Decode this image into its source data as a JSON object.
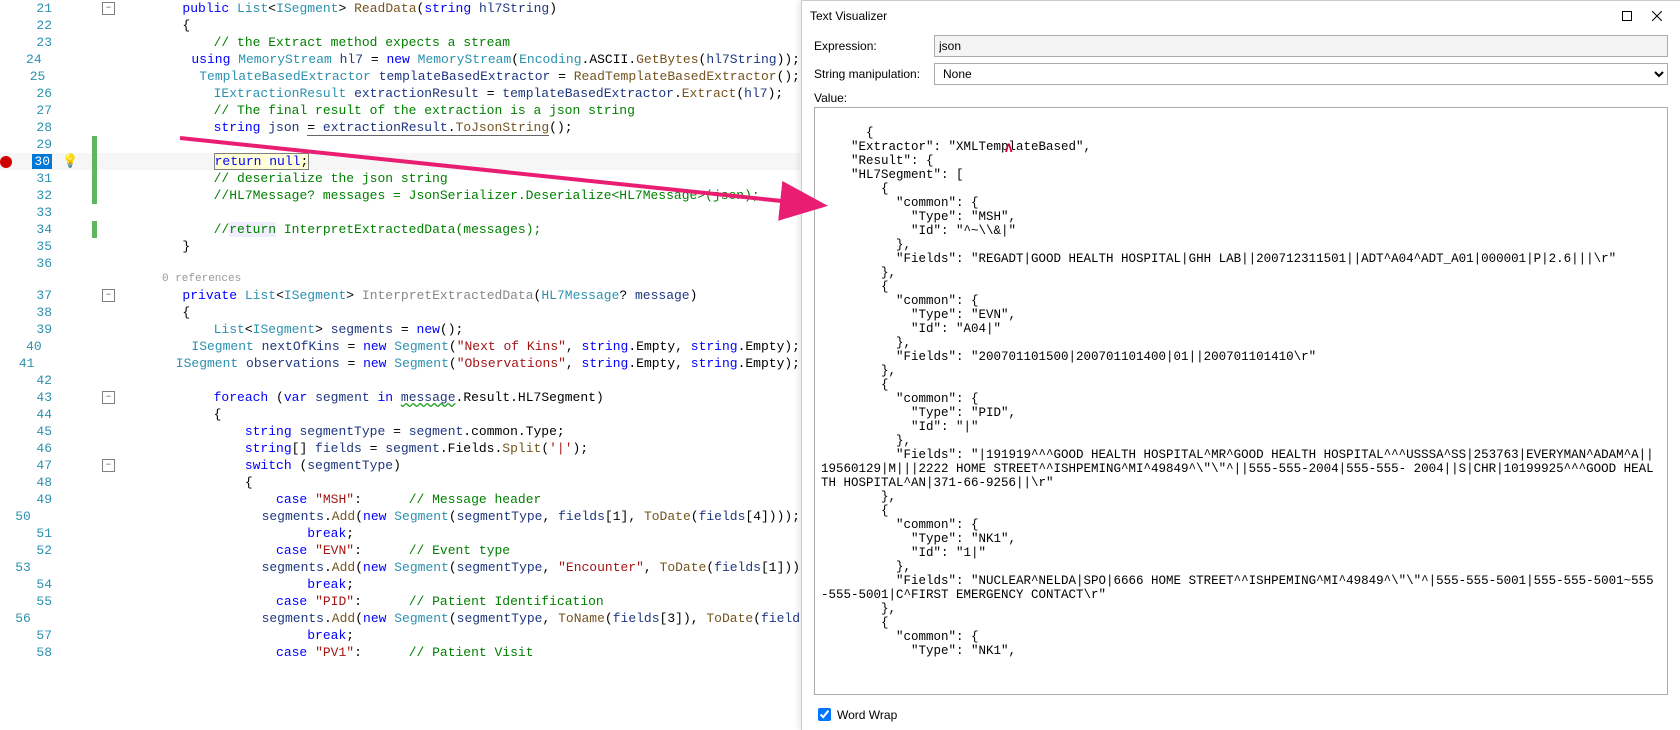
{
  "editor": {
    "lines": [
      {
        "n": 21,
        "fold": "m",
        "html": "<span class='kw'>public</span> <span class='tp'>List</span>&lt;<span class='tp'>ISegment</span>&gt; <span class='mth'>ReadData</span>(<span class='kw'>string</span> <span class='loc'>hl7String</span>)"
      },
      {
        "n": 22,
        "html": "{"
      },
      {
        "n": 23,
        "html": "    <span class='cmt'>// the Extract method expects a stream</span>"
      },
      {
        "n": 24,
        "html": "    <span class='kw'>using</span> <span class='tp'>MemoryStream</span> <span class='loc'>hl7</span> = <span class='kw'>new</span> <span class='tp'>MemoryStream</span>(<span class='tp'>Encoding</span>.ASCII.<span class='mth'>GetBytes</span>(<span class='loc'>hl7String</span>));"
      },
      {
        "n": 25,
        "html": "    <span class='tp'>TemplateBasedExtractor</span> <span class='loc'>templateBasedExtractor</span> = <span class='mth'>ReadTemplateBasedExtractor</span>();"
      },
      {
        "n": 26,
        "html": "    <span class='tp'>IExtractionResult</span> <span class='loc'>extractionResult</span> = <span class='loc'>templateBasedExtractor</span>.<span class='mth'>Extract</span>(<span class='loc'>hl7</span>);"
      },
      {
        "n": 27,
        "html": "    <span class='cmt'>// The final result of the extraction is a json string</span>"
      },
      {
        "n": 28,
        "html": "    <span class='kw'>string</span> <span class='loc'>json</span> <span style='border-bottom:1px solid #666'>= <span class='loc'>extractionResult</span>.<span class='mth'>ToJsonString</span></span>();"
      },
      {
        "n": 29,
        "changed": true,
        "html": ""
      },
      {
        "n": 30,
        "bp": true,
        "hl": true,
        "bulb": true,
        "changed": true,
        "html": "    <span class='boxed'><span class='kw'>return</span> <span class='kw'>null</span>;</span>"
      },
      {
        "n": 31,
        "changed": true,
        "html": "    <span class='cmt'>// deserialize the json string</span>"
      },
      {
        "n": 32,
        "changed": true,
        "html": "    <span class='cmt'>//HL7Message? messages = JsonSerializer.Deserialize&lt;HL7Message&gt;(json);</span>"
      },
      {
        "n": 33,
        "html": ""
      },
      {
        "n": 34,
        "changed": true,
        "html": "    <span class='cmt'>//<span style='background:#eef'>return</span> InterpretExtractedData(messages);</span>"
      },
      {
        "n": 35,
        "html": "}"
      },
      {
        "n": 36,
        "html": ""
      }
    ],
    "refs": "0 references",
    "lines2": [
      {
        "n": 37,
        "fold": "m",
        "html": "<span class='kw'>private</span> <span class='tp'>List</span>&lt;<span class='tp'>ISegment</span>&gt; <span class='gray'>InterpretExtractedData</span>(<span class='tp'>HL7Message</span>? <span class='loc'>message</span>)"
      },
      {
        "n": 38,
        "html": "{"
      },
      {
        "n": 39,
        "html": "    <span class='tp'>List</span>&lt;<span class='tp'>ISegment</span>&gt; <span class='loc'>segments</span> = <span class='kw'>new</span>();"
      },
      {
        "n": 40,
        "html": "    <span class='tp'>ISegment</span> <span class='loc'>nextOfKins</span> = <span class='kw'>new</span> <span class='tp'>Segment</span>(<span class='str'>\"Next of Kins\"</span>, <span class='kw'>string</span>.Empty, <span class='kw'>string</span>.Empty);"
      },
      {
        "n": 41,
        "html": "    <span class='tp'>ISegment</span> <span class='loc'>observations</span> = <span class='kw'>new</span> <span class='tp'>Segment</span>(<span class='str'>\"Observations\"</span>, <span class='kw'>string</span>.Empty, <span class='kw'>string</span>.Empty);"
      },
      {
        "n": 42,
        "html": ""
      },
      {
        "n": 43,
        "fold": "m",
        "html": "    <span class='kw'>foreach</span> (<span class='kw'>var</span> <span class='loc'>segment</span> <span class='kw'>in</span> <span class='loc squig'>message</span>.Result.HL7Segment)"
      },
      {
        "n": 44,
        "html": "    {"
      },
      {
        "n": 45,
        "html": "        <span class='kw'>string</span> <span class='loc'>segmentType</span> = <span class='loc'>segment</span>.common.Type;"
      },
      {
        "n": 46,
        "html": "        <span class='kw'>string</span>[] <span class='loc'>fields</span> = <span class='loc'>segment</span>.Fields.<span class='mth'>Split</span>(<span class='str'>'|'</span>);"
      },
      {
        "n": 47,
        "fold": "m",
        "html": "        <span class='kw'>switch</span> (<span class='loc'>segmentType</span>)"
      },
      {
        "n": 48,
        "html": "        {"
      },
      {
        "n": 49,
        "html": "            <span class='kw'>case</span> <span class='str'>\"MSH\"</span>:      <span class='cmt'>// Message header</span>"
      },
      {
        "n": 50,
        "html": "                <span class='loc'>segments</span>.<span class='mth'>Add</span>(<span class='kw'>new</span> <span class='tp'>Segment</span>(<span class='loc'>segmentType</span>, <span class='loc'>fields</span>[<span class='num'>1</span>], <span class='mth'>ToDate</span>(<span class='loc'>fields</span>[<span class='num'>4</span>])));"
      },
      {
        "n": 51,
        "html": "                <span class='kw'>break</span>;"
      },
      {
        "n": 52,
        "html": "            <span class='kw'>case</span> <span class='str'>\"EVN\"</span>:      <span class='cmt'>// Event type</span>"
      },
      {
        "n": 53,
        "html": "                <span class='loc'>segments</span>.<span class='mth'>Add</span>(<span class='kw'>new</span> <span class='tp'>Segment</span>(<span class='loc'>segmentType</span>, <span class='str'>\"Encounter\"</span>, <span class='mth'>ToDate</span>(<span class='loc'>fields</span>[<span class='num'>1</span>]))"
      },
      {
        "n": 54,
        "html": "                <span class='kw'>break</span>;"
      },
      {
        "n": 55,
        "html": "            <span class='kw'>case</span> <span class='str'>\"PID\"</span>:      <span class='cmt'>// Patient Identification</span>"
      },
      {
        "n": 56,
        "html": "                <span class='loc'>segments</span>.<span class='mth'>Add</span>(<span class='kw'>new</span> <span class='tp'>Segment</span>(<span class='loc'>segmentType</span>, <span class='mth'>ToName</span>(<span class='loc'>fields</span>[<span class='num'>3</span>]), <span class='mth'>ToDate</span>(<span class='loc'>field</span>"
      },
      {
        "n": 57,
        "html": "                <span class='kw'>break</span>;"
      },
      {
        "n": 58,
        "html": "            <span class='kw'>case</span> <span class='str'>\"PV1\"</span>:      <span class='cmt'>// Patient Visit</span>"
      }
    ]
  },
  "dialog": {
    "title": "Text Visualizer",
    "expr_label": "Expression:",
    "expr_value": "json",
    "manip_label": "String manipulation:",
    "manip_value": "None",
    "value_label": "Value:",
    "wrap_label": "Word Wrap",
    "json_text": "{\n    \"Extractor\": \"XMLTemplateBased\",\n    \"Result\": {\n    \"HL7Segment\": [\n        {\n          \"common\": {\n            \"Type\": \"MSH\",\n            \"Id\": \"^~\\\\&|\"\n          },\n          \"Fields\": \"REGADT|GOOD HEALTH HOSPITAL|GHH LAB||200712311501||ADT^A04^ADT_A01|000001|P|2.6|||\\r\"\n        },\n        {\n          \"common\": {\n            \"Type\": \"EVN\",\n            \"Id\": \"A04|\"\n          },\n          \"Fields\": \"200701101500|200701101400|01||200701101410\\r\"\n        },\n        {\n          \"common\": {\n            \"Type\": \"PID\",\n            \"Id\": \"|\"\n          },\n          \"Fields\": \"|191919^^^GOOD HEALTH HOSPITAL^MR^GOOD HEALTH HOSPITAL^^^USSSA^SS|253763|EVERYMAN^ADAM^A||19560129|M|||2222 HOME STREET^^ISHPEMING^MI^49849^\\\"\\\"^||555-555-2004|555-555- 2004||S|CHR|10199925^^^GOOD HEALTH HOSPITAL^AN|371-66-9256||\\r\"\n        },\n        {\n          \"common\": {\n            \"Type\": \"NK1\",\n            \"Id\": \"1|\"\n          },\n          \"Fields\": \"NUCLEAR^NELDA|SPO|6666 HOME STREET^^ISHPEMING^MI^49849^\\\"\\\"^|555-555-5001|555-555-5001~555-555-5001|C^FIRST EMERGENCY CONTACT\\r\"\n        },\n        {\n          \"common\": {\n            \"Type\": \"NK1\","
  }
}
